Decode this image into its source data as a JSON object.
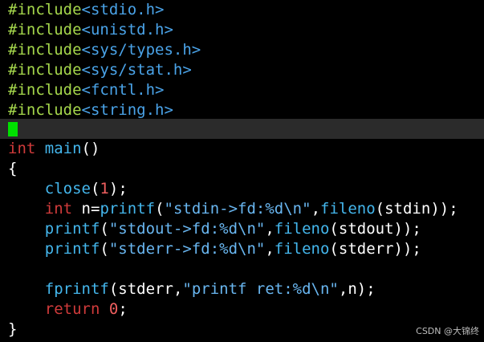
{
  "editor": {
    "background": "#000000",
    "cursorline_color": "#2b2b2b",
    "cursor_color": "#00e000",
    "lines": [
      {
        "directive": "#include",
        "header": "<stdio.h>"
      },
      {
        "directive": "#include",
        "header": "<unistd.h>"
      },
      {
        "directive": "#include",
        "header": "<sys/types.h>"
      },
      {
        "directive": "#include",
        "header": "<sys/stat.h>"
      },
      {
        "directive": "#include",
        "header": "<fcntl.h>"
      },
      {
        "directive": "#include",
        "header": "<string.h>"
      }
    ],
    "main_sig": {
      "type": "int",
      "name": "main",
      "args": "()"
    },
    "open_brace": "{",
    "close_brace": "}",
    "body": {
      "close_fn": "close",
      "close_arg": "1",
      "decl_type": "int",
      "decl_var": "n=",
      "printf1_fn": "printf",
      "printf1_str": "\"stdin->fd:%d\\n\"",
      "fileno1_fn": "fileno",
      "fileno1_arg": "stdin",
      "printf2_fn": "printf",
      "printf2_str": "\"stdout->fd:%d\\n\"",
      "fileno2_fn": "fileno",
      "fileno2_arg": "stdout",
      "printf3_fn": "printf",
      "printf3_str": "\"stderr->fd:%d\\n\"",
      "fileno3_fn": "fileno",
      "fileno3_arg": "stderr",
      "fprintf_fn": "fprintf",
      "fprintf_stream": "stderr",
      "fprintf_str": "\"printf ret:%d\\n\"",
      "fprintf_arg": "n",
      "return_kw": "return",
      "return_val": "0"
    }
  },
  "watermark": "CSDN @大锦终"
}
